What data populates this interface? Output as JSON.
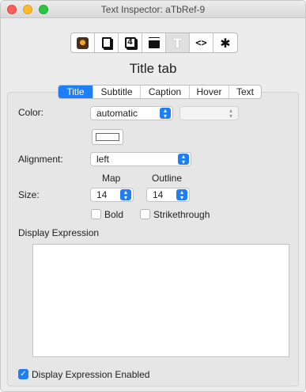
{
  "window": {
    "title": "Text Inspector: aTbRef-9"
  },
  "toolbar": {
    "buttons": [
      {
        "icon": "app-icon"
      },
      {
        "icon": "note-icon"
      },
      {
        "icon": "four-icon",
        "glyph": "4"
      },
      {
        "icon": "shape-icon"
      },
      {
        "icon": "text-icon",
        "glyph": "T"
      },
      {
        "icon": "code-icon",
        "glyph": "<>"
      },
      {
        "icon": "gear-icon",
        "glyph": "✱"
      }
    ]
  },
  "tab_title": "Title tab",
  "tabs": [
    "Title",
    "Subtitle",
    "Caption",
    "Hover",
    "Text"
  ],
  "selected_tab": "Title",
  "form": {
    "color_label": "Color:",
    "color_value": "automatic",
    "color_secondary_value": "",
    "alignment_label": "Alignment:",
    "alignment_value": "left",
    "map_label": "Map",
    "outline_label": "Outline",
    "size_label": "Size:",
    "map_size": "14",
    "outline_size": "14",
    "bold_label": "Bold",
    "bold_checked": false,
    "strikethrough_label": "Strikethrough",
    "strikethrough_checked": false,
    "display_expression_label": "Display Expression",
    "display_expression_value": "",
    "expr_enabled_label": "Display Expression Enabled",
    "expr_enabled_checked": true
  },
  "colors": {
    "accent": "#1d7ef7"
  }
}
